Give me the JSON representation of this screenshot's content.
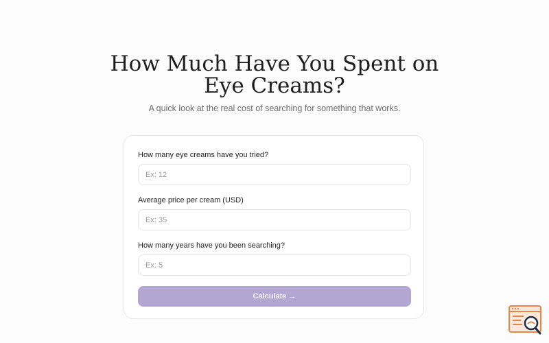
{
  "header": {
    "title_line1": "How Much Have You Spent on",
    "title_line2": "Eye Creams?",
    "subtitle": "A quick look at the real cost of searching for something that works."
  },
  "form": {
    "fields": [
      {
        "label": "How many eye creams have you tried?",
        "placeholder": "Ex: 12",
        "value": ""
      },
      {
        "label": "Average price per cream (USD)",
        "placeholder": "Ex: 35",
        "value": ""
      },
      {
        "label": "How many years have you been searching?",
        "placeholder": "Ex: 5",
        "value": ""
      }
    ],
    "submit_label": "Calculate →"
  },
  "widget": {
    "icon": "search-document-icon",
    "colors": {
      "accent": "#e8864a",
      "magnifier": "#1f2a44"
    }
  },
  "colors": {
    "button_bg": "#b3a6d2",
    "page_bg": "#fcfcfc",
    "card_bg": "#ffffff"
  }
}
